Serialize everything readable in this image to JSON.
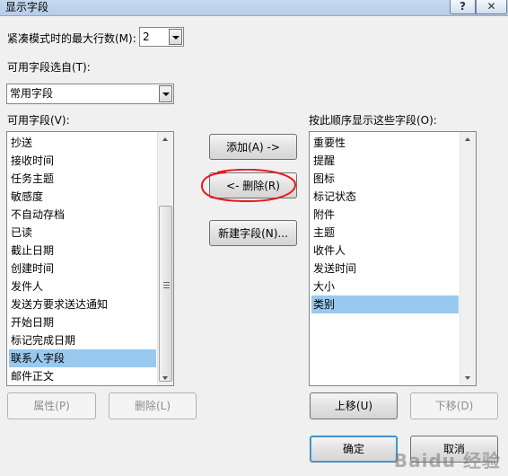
{
  "window": {
    "title": "显示字段",
    "help_label": "?",
    "close_label": "✕"
  },
  "compact": {
    "label": "紧凑模式时的最大行数(M):",
    "value": "2"
  },
  "source": {
    "label": "可用字段选自(T):",
    "value": "常用字段"
  },
  "available": {
    "label": "可用字段(V):",
    "items": [
      "抄送",
      "接收时间",
      "任务主题",
      "敏感度",
      "不自动存档",
      "已读",
      "截止日期",
      "创建时间",
      "发件人",
      "发送方要求送达通知",
      "开始日期",
      "标记完成日期",
      "联系人字段",
      "邮件正文"
    ],
    "selected_index": 12
  },
  "shown": {
    "label": "按此顺序显示这些字段(O):",
    "items": [
      "重要性",
      "提醒",
      "图标",
      "标记状态",
      "附件",
      "主题",
      "收件人",
      "发送时间",
      "大小",
      "类别"
    ],
    "selected_index": 9
  },
  "buttons": {
    "add": "添加(A) ->",
    "remove": "<- 删除(R)",
    "new_field": "新建字段(N)...",
    "properties": "属性(P)",
    "delete": "删除(L)",
    "move_up": "上移(U)",
    "move_down": "下移(D)",
    "ok": "确定",
    "cancel": "取消"
  },
  "colors": {
    "selection": "#99c9ef",
    "annotation": "#e8171b"
  },
  "watermark": "Baidu 经验"
}
